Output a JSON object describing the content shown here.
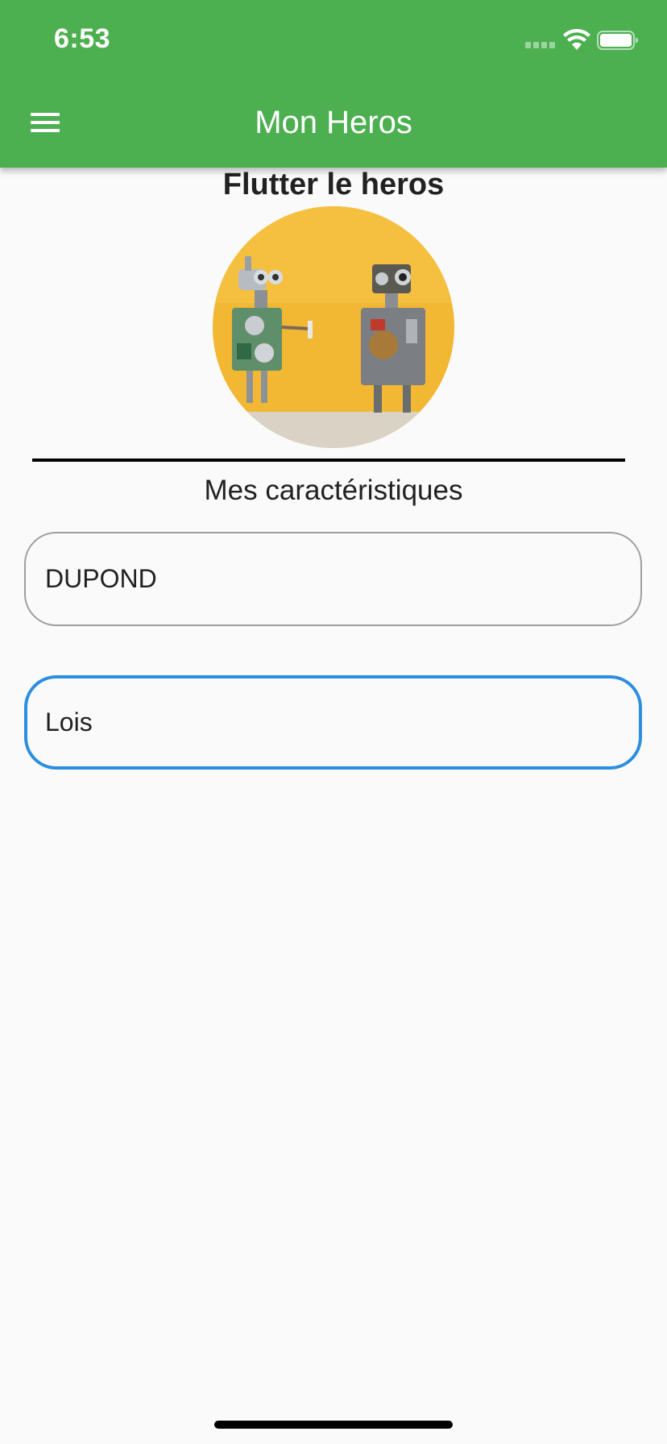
{
  "colors": {
    "app_bar": "#4CAF50",
    "background": "#FAFAFA",
    "field_border": "#9E9E9E",
    "field_focus_border": "#2B8EE0",
    "text": "#212121"
  },
  "status_bar": {
    "time": "6:53",
    "icons": [
      "cellular-signal-icon",
      "wifi-icon",
      "battery-icon"
    ]
  },
  "app_bar": {
    "menu_icon": "hamburger-menu-icon",
    "title": "Mon Heros"
  },
  "hero": {
    "name": "Flutter le heros",
    "avatar_description": "two toy robots on yellow background"
  },
  "characteristics": {
    "heading": "Mes caractéristiques",
    "fields": [
      {
        "value": "DUPOND",
        "focused": false
      },
      {
        "value": "Lois",
        "focused": true
      }
    ]
  }
}
